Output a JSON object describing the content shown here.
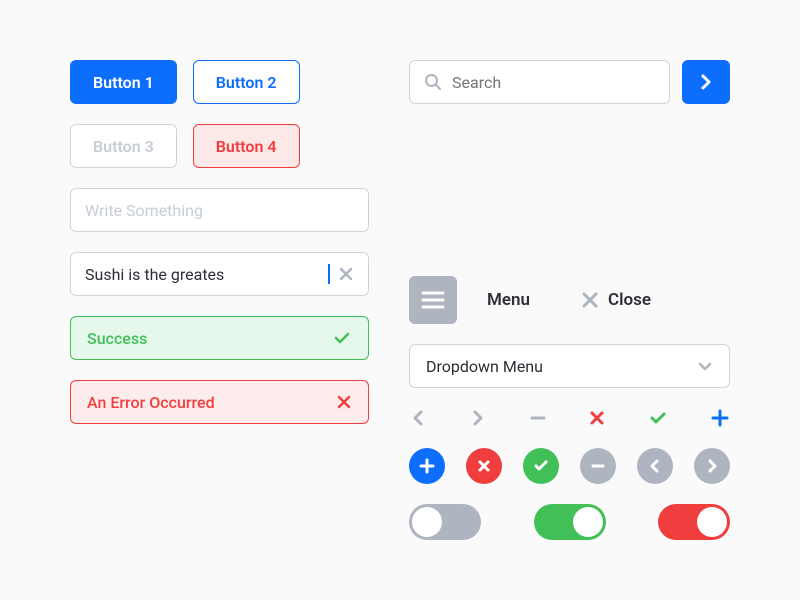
{
  "buttons": {
    "b1": "Button 1",
    "b2": "Button 2",
    "b3": "Button 3",
    "b4": "Button 4"
  },
  "search": {
    "placeholder": "Search"
  },
  "menu": {
    "label": "Menu",
    "close": "Close"
  },
  "inputs": {
    "placeholder": "Write Something",
    "value": "Sushi is the greates"
  },
  "dropdown": {
    "label": "Dropdown Menu"
  },
  "alerts": {
    "success": "Success",
    "error": "An Error Occurred"
  }
}
